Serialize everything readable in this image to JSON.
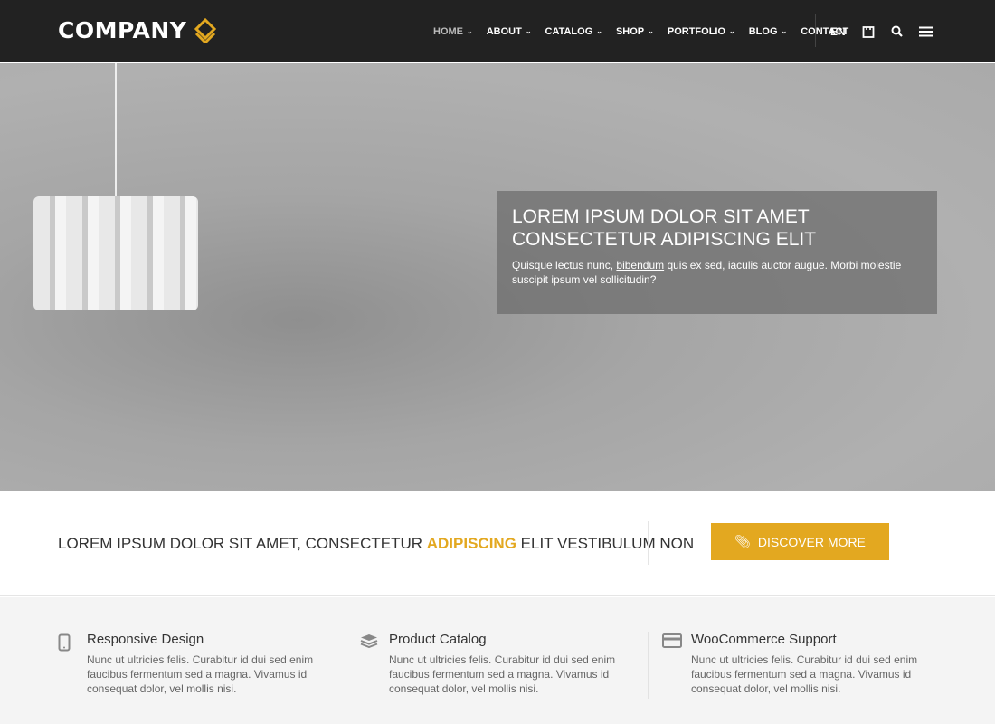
{
  "header": {
    "logo": "COMPANY",
    "accent": "#e3a820",
    "nav": [
      {
        "label": "HOME",
        "dropdown": true,
        "active": true
      },
      {
        "label": "ABOUT",
        "dropdown": true
      },
      {
        "label": "CATALOG",
        "dropdown": true
      },
      {
        "label": "SHOP",
        "dropdown": true
      },
      {
        "label": "PORTFOLIO",
        "dropdown": true
      },
      {
        "label": "BLOG",
        "dropdown": true
      },
      {
        "label": "CONTACT",
        "dropdown": false
      }
    ],
    "language": "EN",
    "icons": [
      "shopping-bag-icon",
      "search-icon",
      "menu-icon"
    ]
  },
  "hero": {
    "title": "LOREM IPSUM DOLOR SIT AMET CONSECTETUR ADIPISCING ELIT",
    "text_before": "Quisque lectus nunc, ",
    "link": "bibendum",
    "text_after": " quis ex sed, iaculis auctor augue. Morbi molestie suscipit ipsum vel sollicitudin?"
  },
  "cta": {
    "text_before": "LOREM IPSUM DOLOR SIT AMET, CONSECTETUR ",
    "highlight": "ADIPISCING",
    "text_after": " ELIT VESTIBULUM NON",
    "button": "DISCOVER MORE"
  },
  "features": [
    {
      "icon": "mobile-icon",
      "title": "Responsive Design",
      "text": "Nunc ut ultricies felis. Curabitur id dui sed enim faucibus fermentum sed a magna. Vivamus id consequat dolor, vel mollis nisi."
    },
    {
      "icon": "layers-icon",
      "title": "Product Catalog",
      "text": "Nunc ut ultricies felis. Curabitur id dui sed enim faucibus fermentum sed a magna. Vivamus id consequat dolor, vel mollis nisi."
    },
    {
      "icon": "credit-card-icon",
      "title": "WooCommerce Support",
      "text": "Nunc ut ultricies felis. Curabitur id dui sed enim faucibus fermentum sed a magna. Vivamus id consequat dolor, vel mollis nisi."
    }
  ]
}
